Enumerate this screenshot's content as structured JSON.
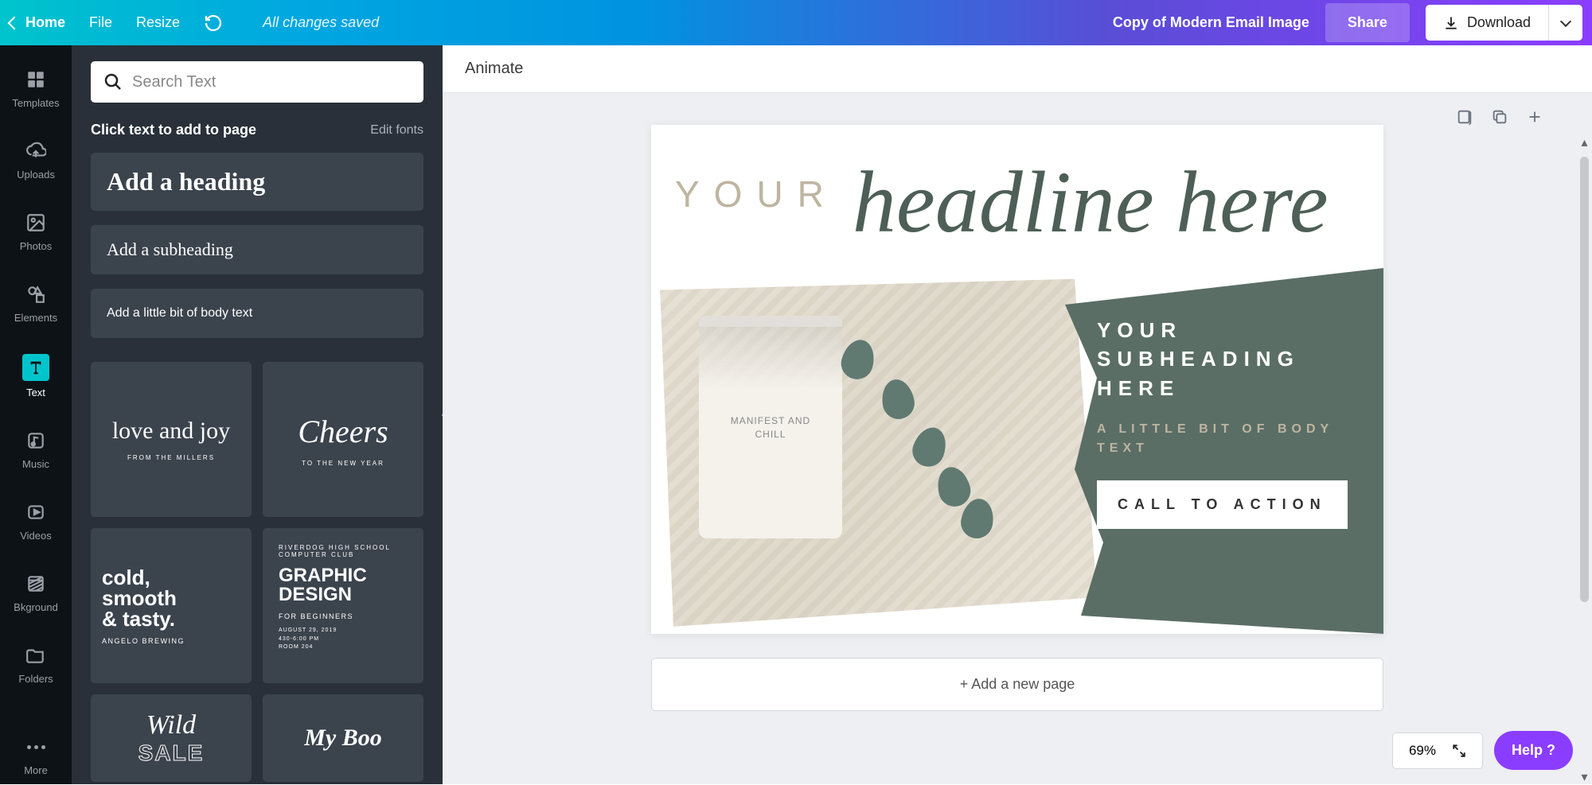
{
  "topbar": {
    "home": "Home",
    "file": "File",
    "resize": "Resize",
    "saved_status": "All changes saved",
    "doc_title": "Copy of Modern Email Image",
    "share": "Share",
    "download": "Download"
  },
  "rail": {
    "templates": "Templates",
    "uploads": "Uploads",
    "photos": "Photos",
    "elements": "Elements",
    "text": "Text",
    "music": "Music",
    "videos": "Videos",
    "bkground": "Bkground",
    "folders": "Folders",
    "more": "More"
  },
  "panel": {
    "search_placeholder": "Search Text",
    "lead": "Click text to add to page",
    "edit_fonts": "Edit fonts",
    "heading_opt": "Add a heading",
    "subheading_opt": "Add a subheading",
    "body_opt": "Add a little bit of body text",
    "tiles": {
      "t1_script": "love and joy",
      "t1_sub": "FROM THE MILLERS",
      "t2_script": "Cheers",
      "t2_sub": "TO THE NEW YEAR",
      "t3_big1": "cold,",
      "t3_big2": "smooth",
      "t3_big3": "& tasty.",
      "t3_sub": "ANGELO BREWING",
      "t4_top": "RIVERDOG HIGH SCHOOL\nCOMPUTER CLUB",
      "t4_big1": "GRAPHIC",
      "t4_big2": "DESIGN",
      "t4_sub": "FOR BEGINNERS",
      "t4_event": "AUGUST 29, 2019\n430-6:00 PM\nROOM 204",
      "t5_top": "Wild",
      "t5_sub": "SALE",
      "t6_script": "My Boo"
    }
  },
  "canvas": {
    "animate": "Animate",
    "headline_your": "YOUR",
    "headline_script": "headline here",
    "subheading": "YOUR SUBHEADING HERE",
    "body": "A LITTLE BIT OF BODY TEXT",
    "cta": "CALL TO ACTION",
    "jar_label": "MANIFEST AND CHILL",
    "add_page": "+ Add a new page"
  },
  "footer": {
    "zoom": "69%",
    "help": "Help ?"
  }
}
